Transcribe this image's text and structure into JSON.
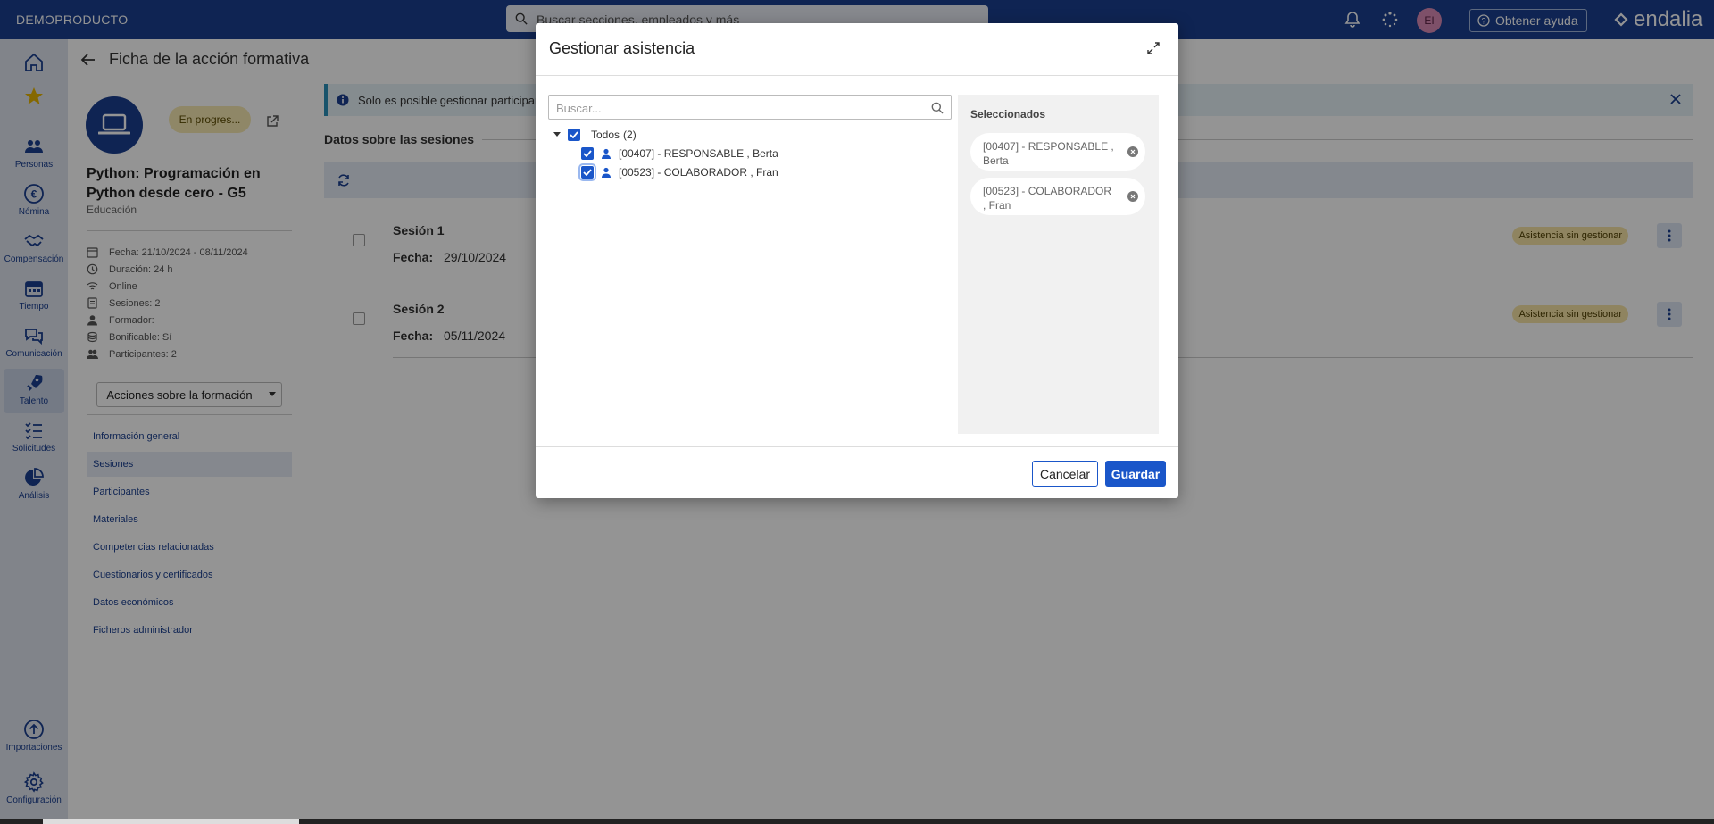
{
  "topbar": {
    "brand": "DEMOPRODUCTO",
    "search_placeholder": "Buscar secciones, empleados y más",
    "avatar_initials": "EI",
    "help_label": "Obtener ayuda",
    "logo_text": "endalia"
  },
  "nav": {
    "items": [
      {
        "label": "",
        "icon": "home-icon"
      },
      {
        "label": "",
        "icon": "star-icon"
      },
      {
        "label": "Personas",
        "icon": "people-icon"
      },
      {
        "label": "Nómina",
        "icon": "euro-icon"
      },
      {
        "label": "Compensación",
        "icon": "handshake-icon"
      },
      {
        "label": "Tiempo",
        "icon": "calendar-icon"
      },
      {
        "label": "Comunicación",
        "icon": "chat-icon"
      },
      {
        "label": "Talento",
        "icon": "rocket-icon"
      },
      {
        "label": "Solicitudes",
        "icon": "checklist-icon"
      },
      {
        "label": "Análisis",
        "icon": "pie-icon"
      },
      {
        "label": "Importaciones",
        "icon": "upload-icon"
      },
      {
        "label": "Configuración",
        "icon": "gear-icon"
      }
    ]
  },
  "page": {
    "title": "Ficha de la acción formativa",
    "status": "En progres...",
    "course_title": "Python: Programación en Python desde cero - G5",
    "category": "Educación",
    "meta": [
      {
        "icon": "calendar-icon",
        "text": "Fecha: 21/10/2024 - 08/11/2024"
      },
      {
        "icon": "clock-icon",
        "text": "Duración: 24 h"
      },
      {
        "icon": "wifi-icon",
        "text": "Online"
      },
      {
        "icon": "document-icon",
        "text": "Sesiones: 2"
      },
      {
        "icon": "person-icon",
        "text": "Formador:"
      },
      {
        "icon": "coins-icon",
        "text": "Bonificable: Sí"
      },
      {
        "icon": "group-icon",
        "text": "Participantes: 2"
      }
    ],
    "actions_label": "Acciones sobre la formación",
    "side_links": [
      "Información general",
      "Sesiones",
      "Participantes",
      "Materiales",
      "Competencias relacionadas",
      "Cuestionarios y certificados",
      "Datos económicos",
      "Ficheros administrador"
    ],
    "active_link": "Sesiones",
    "info_banner": "Solo es posible gestionar participan",
    "section_title": "Datos sobre las sesiones",
    "sessions": [
      {
        "name": "Sesión 1",
        "fecha_label": "Fecha:",
        "fecha": "29/10/2024",
        "badge": "Asistencia sin gestionar"
      },
      {
        "name": "Sesión 2",
        "fecha_label": "Fecha:",
        "fecha": "05/11/2024",
        "badge": "Asistencia sin gestionar"
      }
    ]
  },
  "modal": {
    "title": "Gestionar asistencia",
    "search_placeholder": "Buscar...",
    "tree": {
      "root_label": "Todos",
      "root_count": "(2)",
      "items": [
        {
          "label": "[00407] - RESPONSABLE , Berta",
          "checked": true
        },
        {
          "label": "[00523] - COLABORADOR , Fran",
          "checked": true
        }
      ]
    },
    "selected_title": "Seleccionados",
    "selected": [
      "[00407] - RESPONSABLE , Berta",
      "[00523] - COLABORADOR , Fran"
    ],
    "cancel_label": "Cancelar",
    "save_label": "Guardar"
  },
  "colors": {
    "brand": "#1a3f8f",
    "primary_button": "#1a56c9",
    "badge": "#f7e3a6"
  }
}
